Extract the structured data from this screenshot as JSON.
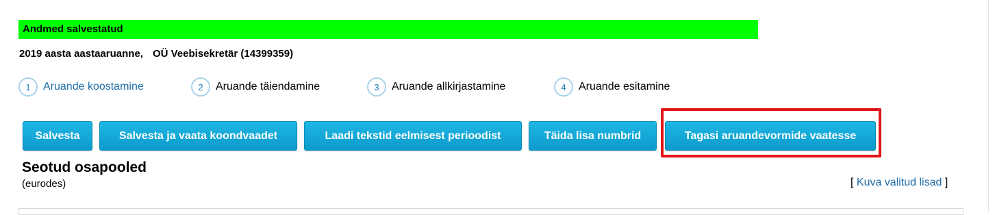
{
  "status": {
    "message": "Andmed salvestatud",
    "color": "#00ff00"
  },
  "report": {
    "title": "2019 aasta aastaaruanne,",
    "company": "OÜ Veebisekretär (14399359)"
  },
  "steps": [
    {
      "number": "1",
      "label": "Aruande koostamine",
      "active": true
    },
    {
      "number": "2",
      "label": "Aruande täiendamine",
      "active": false
    },
    {
      "number": "3",
      "label": "Aruande allkirjastamine",
      "active": false
    },
    {
      "number": "4",
      "label": "Aruande esitamine",
      "active": false
    }
  ],
  "toolbar": {
    "save": "Salvesta",
    "save_and_view": "Salvesta ja vaata koondvaadet",
    "load_texts": "Laadi tekstid eelmisest perioodist",
    "fill_numbers": "Täida lisa numbrid",
    "back_to_forms": "Tagasi aruandevormide vaatesse"
  },
  "section": {
    "title": "Seotud osapooled",
    "subtitle": "(eurodes)",
    "bracket_open": "[ ",
    "show_link": "Kuva valitud lisad",
    "bracket_close": " ]"
  },
  "colors": {
    "button": "#12a8d8",
    "link": "#1f6fa8",
    "highlight": "#e2141a"
  }
}
